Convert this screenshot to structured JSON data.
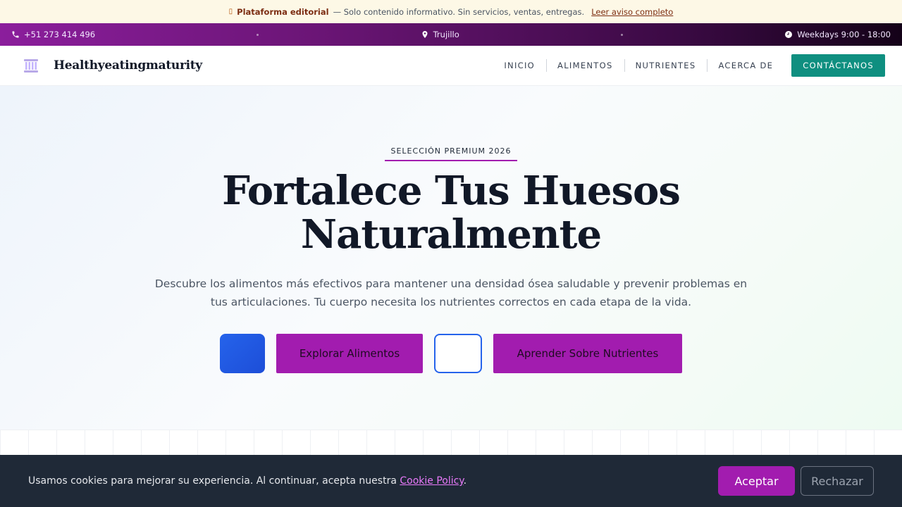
{
  "notice": {
    "icon": "warning-icon",
    "strong": "Plataforma editorial",
    "text": "— Solo contenido informativo. Sin servicios, ventas, entregas.",
    "link": "Leer aviso completo"
  },
  "infobar": {
    "phone": "+51 273 414 496",
    "location": "Trujillo",
    "hours": "Weekdays 9:00 - 18:00"
  },
  "header": {
    "brand": "Healthyeatingmaturity",
    "logo_icon": "column-pillar-icon",
    "nav": [
      "INICIO",
      "ALIMENTOS",
      "NUTRIENTES",
      "ACERCA DE"
    ],
    "cta": "CONTÁCTANOS"
  },
  "hero": {
    "badge": "SELECCIÓN PREMIUM 2026",
    "title_line1": "Fortalece Tus Huesos",
    "title_line2": "Naturalmente",
    "subtitle": "Descubre los alimentos más efectivos para mantener una densidad ósea saludable y prevenir problemas en tus articulaciones. Tu cuerpo necesita los nutrientes correctos en cada etapa de la vida.",
    "buttons": {
      "explore": "Explorar Alimentos",
      "learn": "Aprender Sobre Nutrientes"
    }
  },
  "cookie": {
    "text": "Usamos cookies para mejorar su experiencia. Al continuar, acepta nuestra",
    "policy": "Cookie Policy",
    "period": ".",
    "accept": "Aceptar",
    "reject": "Rechazar"
  },
  "colors": {
    "accent_purple": "#a21caf",
    "teal": "#0f8f80",
    "blue": "#2563eb",
    "cookie_bg": "#1f2937"
  }
}
